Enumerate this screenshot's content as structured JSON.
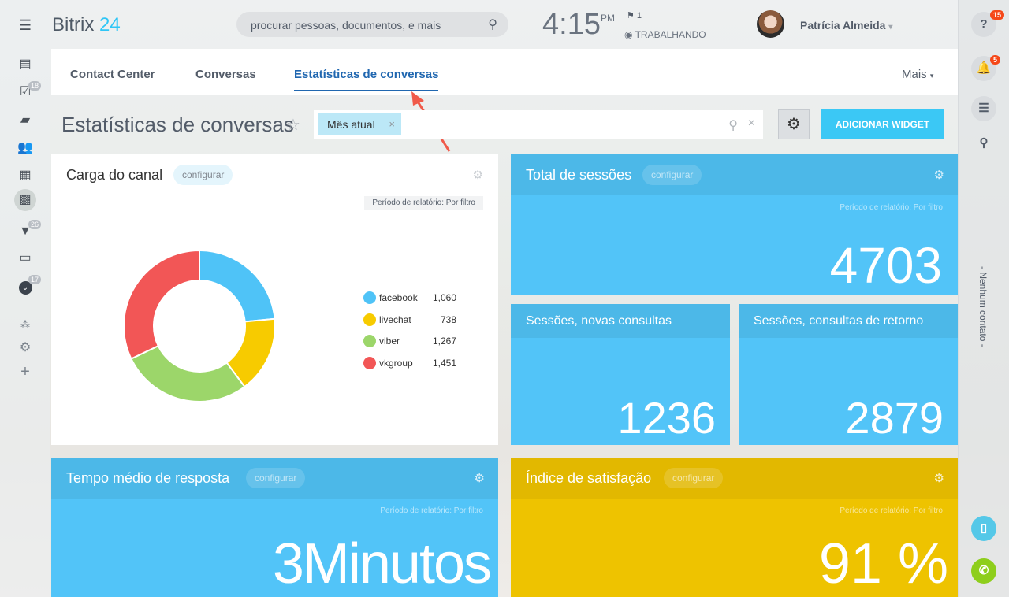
{
  "app": {
    "logo_main": "Bitrix",
    "logo_num": "24"
  },
  "header": {
    "search_placeholder": "procurar pessoas, documentos, e mais",
    "time": "4:15",
    "ampm": "PM",
    "flag_count": "1",
    "status": "TRABALHANDO",
    "user_name": "Patrícia Almeida"
  },
  "left_sidebar": {
    "badges": {
      "tasks": "18",
      "crm": "26",
      "more": "17"
    }
  },
  "right_sidebar": {
    "help_badge": "15",
    "notifications_badge": "5",
    "contacts_label": "- Nenhum contato -"
  },
  "tabs": [
    {
      "label": "Contact Center"
    },
    {
      "label": "Conversas"
    },
    {
      "label": "Estatísticas de conversas",
      "active": true
    },
    {
      "label": "Mais"
    }
  ],
  "page": {
    "title": "Estatísticas de conversas",
    "filter_chip": "Mês atual",
    "add_widget": "ADICIONAR WIDGET"
  },
  "widgets": {
    "channel_load": {
      "title": "Carga do canal",
      "configure": "configurar",
      "period": "Período de relatório: Por filtro"
    },
    "total_sessions": {
      "title": "Total de sessões",
      "configure": "configurar",
      "period": "Período de relatório: Por filtro",
      "value": "4703"
    },
    "new_sessions": {
      "title": "Sessões, novas consultas",
      "value": "1236"
    },
    "return_sessions": {
      "title": "Sessões, consultas de retorno",
      "value": "2879"
    },
    "response_time": {
      "title": "Tempo médio de resposta",
      "configure": "configurar",
      "period": "Período de relatório: Por filtro",
      "value": "3Minutos"
    },
    "satisfaction": {
      "title": "Índice de satisfação",
      "configure": "configurar",
      "period": "Período de relatório: Por filtro",
      "value": "91 %"
    }
  },
  "colors": {
    "accent": "#2fc6f6",
    "tab_active": "#2067b0",
    "widget_blue": "#52c4f8",
    "widget_yellow": "#eec300"
  },
  "chart_data": {
    "type": "pie",
    "donut": true,
    "categories": [
      "facebook",
      "livechat",
      "viber",
      "vkgroup"
    ],
    "values": [
      1060,
      738,
      1267,
      1451
    ],
    "labels": [
      "1,060",
      "738",
      "1,267",
      "1,451"
    ],
    "colors": [
      "#4fc3f7",
      "#f7cb00",
      "#9cd66a",
      "#f25656"
    ],
    "legend": "right"
  }
}
